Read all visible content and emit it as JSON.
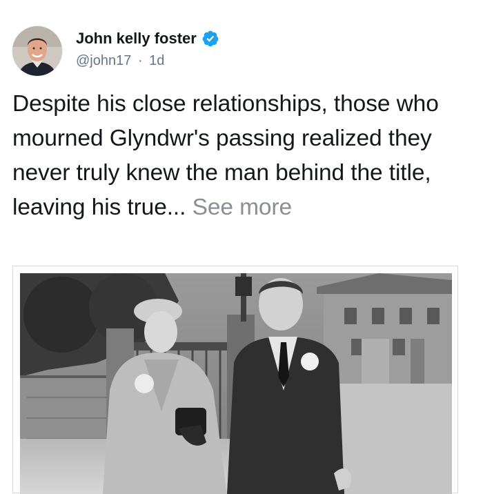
{
  "tweet": {
    "author": {
      "display_name": "John kelly foster",
      "handle": "@john17",
      "verified": true,
      "avatar_icon": "avatar-photo"
    },
    "separator": "·",
    "time": "1d",
    "text": "Despite his close relationships, those who mourned Glyndwr's passing realized they never truly knew the man behind the title, leaving his true...",
    "see_more_label": "See more",
    "media": {
      "type": "photo",
      "icon": "black-and-white-photo"
    }
  },
  "colors": {
    "verified_badge": "#1da1f2",
    "handle": "#657786",
    "see_more": "#8a8d91",
    "text": "#14171a"
  }
}
